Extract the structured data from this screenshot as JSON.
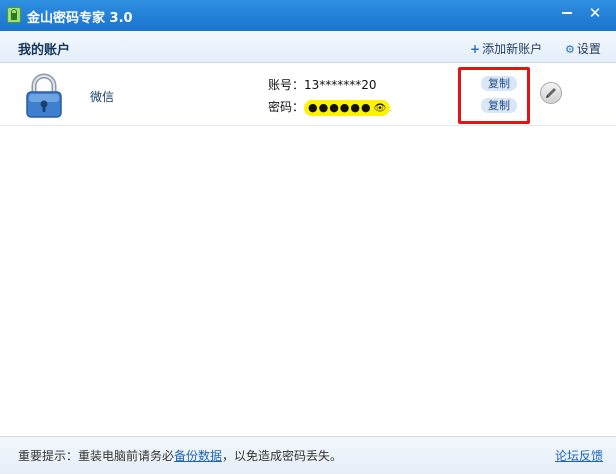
{
  "window": {
    "title": "金山密码专家 3.0",
    "minimize_icon": "minimize-icon",
    "close_icon": "close-icon",
    "close_glyph": "✕"
  },
  "header": {
    "title": "我的账户",
    "add_account_label": "添加新账户",
    "settings_label": "设置",
    "plus_glyph": "+",
    "gear_glyph": "⚙"
  },
  "accounts": [
    {
      "name": "微信",
      "username_label": "账号：",
      "username_value": "13*******20",
      "password_label": "密码：",
      "password_mask": "●●●●●●",
      "eye_glyph": "👁",
      "copy_label": "复制",
      "icon": "lock-icon"
    }
  ],
  "footer": {
    "tip_prefix": "重要提示：重装电脑前请务必",
    "tip_link": "备份数据",
    "tip_suffix": "，以免造成密码丢失。",
    "feedback_label": "论坛反馈"
  },
  "colors": {
    "titlebar": "#1a73cf",
    "highlight": "#e31414",
    "password_mask_bg": "#fff200"
  }
}
